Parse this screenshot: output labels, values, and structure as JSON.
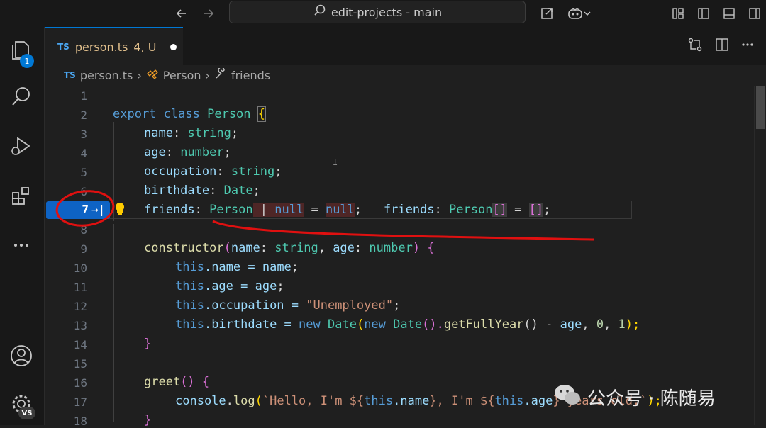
{
  "titlebar": {
    "search_label": "edit-projects - main"
  },
  "activity": {
    "explorer_badge": "1",
    "accounts_badge": "VS"
  },
  "tab": {
    "lang": "TS",
    "filename": "person.ts",
    "status": "4, U"
  },
  "breadcrumbs": [
    {
      "label": "person.ts",
      "lang": "TS"
    },
    {
      "label": "Person"
    },
    {
      "label": "friends"
    }
  ],
  "line_numbers": [
    "1",
    "2",
    "3",
    "4",
    "5",
    "6",
    "7",
    "8",
    "9",
    "10",
    "11",
    "12",
    "13",
    "14",
    "15",
    "16",
    "17",
    "18"
  ],
  "current_line": {
    "number": "7",
    "icon": "→|"
  },
  "code": {
    "l2": [
      "export",
      "class",
      "Person",
      "{"
    ],
    "l3": [
      "name",
      ": ",
      "string",
      ";"
    ],
    "l4": [
      "age",
      ": ",
      "number",
      ";"
    ],
    "l5": [
      "occupation",
      ": ",
      "string",
      ";"
    ],
    "l6": [
      "birthdate",
      ": ",
      "Date",
      ";"
    ],
    "l7_old": [
      "friends",
      ": ",
      "Person",
      " | ",
      "null",
      " = ",
      "null",
      ";"
    ],
    "l7_new": [
      "friends",
      ": ",
      "Person",
      "[]",
      " = ",
      "[]",
      ";"
    ],
    "l9": [
      "constructor",
      "(",
      "name",
      ": ",
      "string",
      ", ",
      "age",
      ": ",
      "number",
      ") ",
      "{"
    ],
    "l10": [
      "this",
      ".name = ",
      "name",
      ";"
    ],
    "l11": [
      "this",
      ".age = ",
      "age",
      ";"
    ],
    "l12": [
      "this",
      ".occupation = ",
      "\"Unemployed\"",
      ";"
    ],
    "l13": [
      "this",
      ".birthdate = ",
      "new",
      " ",
      "Date",
      "(",
      "new",
      " ",
      "Date",
      "().",
      "getFullYear",
      "() - ",
      "age",
      ", ",
      "0",
      ", ",
      "1",
      ");"
    ],
    "l14": [
      "}"
    ],
    "l16": [
      "greet",
      "() ",
      "{"
    ],
    "l17": [
      "console",
      ".",
      "log",
      "(",
      "`Hello, I'm ${",
      "this",
      ".name",
      "}, I'm ${",
      "this",
      ".age",
      "} years old.`",
      ");"
    ],
    "l18": [
      "}"
    ]
  },
  "watermark": {
    "text": "公众号 · 陈随易"
  },
  "colors": {
    "accent": "#0078d4",
    "annotation": "#e01010"
  }
}
